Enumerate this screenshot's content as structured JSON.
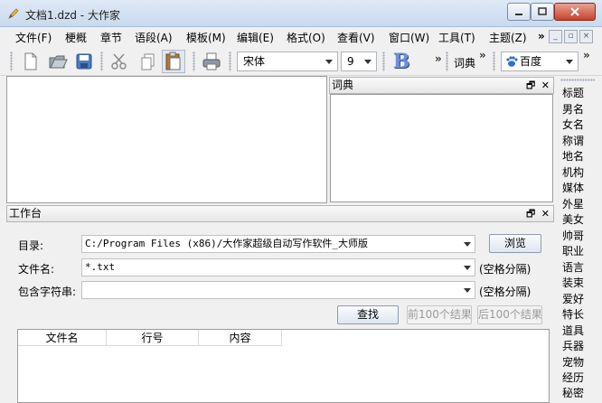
{
  "window": {
    "title": "文档1.dzd - 大作家"
  },
  "menu": {
    "items": [
      "文件(F)",
      "梗概",
      "章节",
      "语段(A)",
      "模板(M)",
      "编辑(E)",
      "格式(O)",
      "查看(V)",
      "窗口(W)",
      "工具(T)",
      "主题(Z)"
    ],
    "overflow": "»"
  },
  "toolbar": {
    "font_name": "宋体",
    "font_size": "9",
    "bold_glyph": "B",
    "overflow": "»",
    "dict_label": "词典",
    "search_engine": "百度",
    "overflow2": "»"
  },
  "dict_panel": {
    "title": "词典"
  },
  "sidebar": {
    "items": [
      "标题",
      "男名",
      "女名",
      "称谓",
      "地名",
      "机构",
      "媒体",
      "外星",
      "美女",
      "帅哥",
      "职业",
      "语言",
      "装束",
      "爱好",
      "特长",
      "道具",
      "兵器",
      "宠物",
      "经历",
      "秘密"
    ]
  },
  "workbench": {
    "title": "工作台",
    "dir_label": "目录:",
    "dir_value": "C:/Program Files (x86)/大作家超级自动写作软件_大师版",
    "browse_button": "浏览",
    "filename_label": "文件名:",
    "filename_value": "*.txt",
    "filename_hint": "(空格分隔)",
    "contains_label": "包含字符串:",
    "contains_value": "",
    "contains_hint": "(空格分隔)",
    "find_button": "查找",
    "prev_button": "前100个结果",
    "next_button": "后100个结果",
    "columns": [
      "文件名",
      "行号",
      "内容"
    ]
  },
  "colors": {
    "titlebar": "#c9daee",
    "close": "#c7432e",
    "accent": "#2a64b8"
  }
}
